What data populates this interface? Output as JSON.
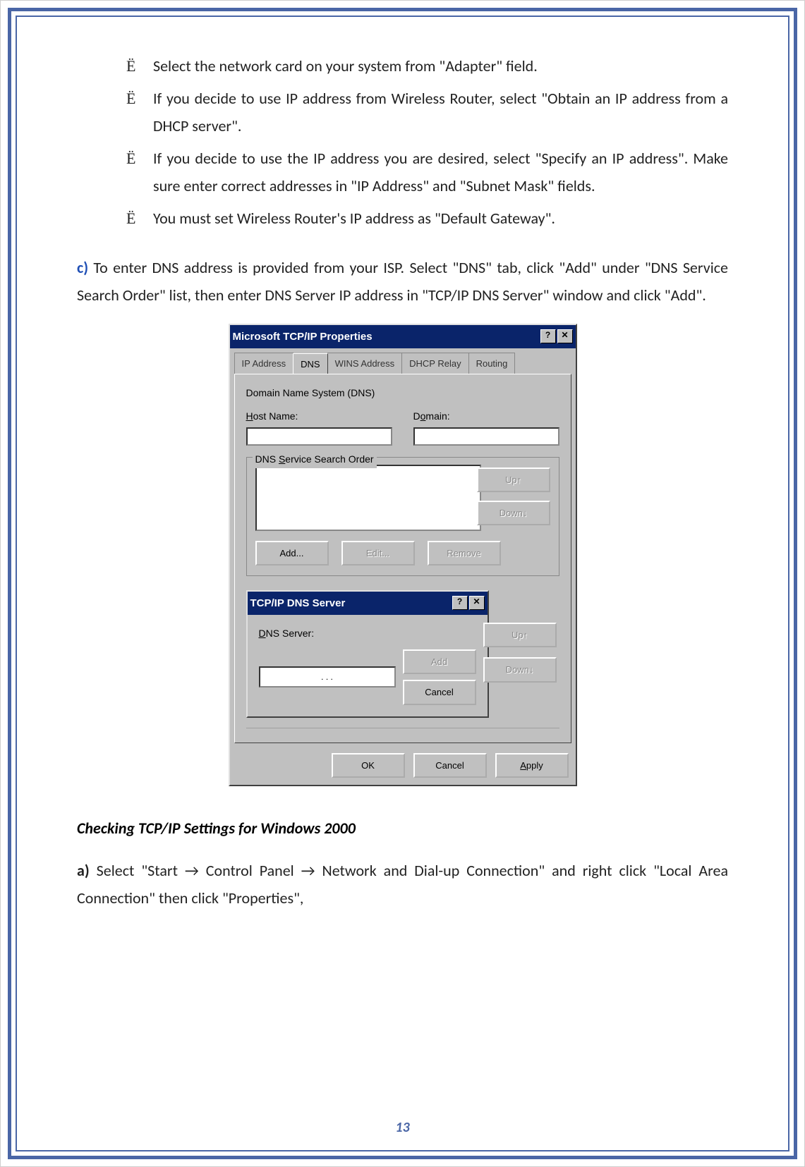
{
  "page_number": "13",
  "bullets": [
    "Select the network card on your system from \"Adapter\" field.",
    "If you decide to use IP address from Wireless Router, select \"Obtain an IP address from a DHCP server\".",
    "If you decide to use the IP address you are desired, select \"Specify an IP address\". Make sure enter correct addresses in \"IP Address\" and \"Subnet Mask\" fields.",
    "You must set Wireless Router's IP address as \"Default Gateway\"."
  ],
  "bullet_marker": "Ё",
  "section_c_prefix": "c)",
  "section_c_text": " To enter DNS address is provided from your ISP. Select \"DNS\" tab, click \"Add\" under \"DNS Service Search Order\" list, then enter DNS Server IP address in \"TCP/IP DNS Server\" window and click \"Add\".",
  "heading_win2000": "Checking TCP/IP Settings for Windows 2000",
  "section_a_prefix": "a)",
  "section_a_text_1": " Select \"Start ",
  "section_a_text_2": " Control Panel ",
  "section_a_text_3": " Network and Dial-up Connection\" and right click \"Local Area Connection\" then click \"Properties\",",
  "arrow": "→",
  "dialog": {
    "title": "Microsoft TCP/IP Properties",
    "help_btn": "?",
    "close_btn": "✕",
    "tabs": [
      "IP Address",
      "DNS",
      "WINS Address",
      "DHCP Relay",
      "Routing"
    ],
    "active_tab_index": 1,
    "dns_section_label": "Domain Name System (DNS)",
    "hostname_label_pre": "H",
    "hostname_label_post": "ost Name:",
    "domain_label_pre": "D",
    "domain_label_mid": "o",
    "domain_label_post": "main:",
    "group_label_pre": "DNS ",
    "group_label_u": "S",
    "group_label_post": "ervice Search Order",
    "up_btn": "Up↑",
    "down_btn": "Down↓",
    "add_btn": "Add...",
    "edit_btn": "Edit...",
    "remove_btn": "Remove",
    "ok_btn": "OK",
    "cancel_btn": "Cancel",
    "apply_btn_pre": "A",
    "apply_btn_u": "p",
    "apply_btn_post": "ply"
  },
  "sub_dialog": {
    "title": "TCP/IP DNS Server",
    "help_btn": "?",
    "close_btn": "✕",
    "label_pre": "D",
    "label_u": "N",
    "label_post": "S Server:",
    "add_btn": "Add",
    "cancel_btn": "Cancel",
    "up_btn": "Up↑",
    "down_btn": "Down↓",
    "ip_dots": ". . ."
  }
}
